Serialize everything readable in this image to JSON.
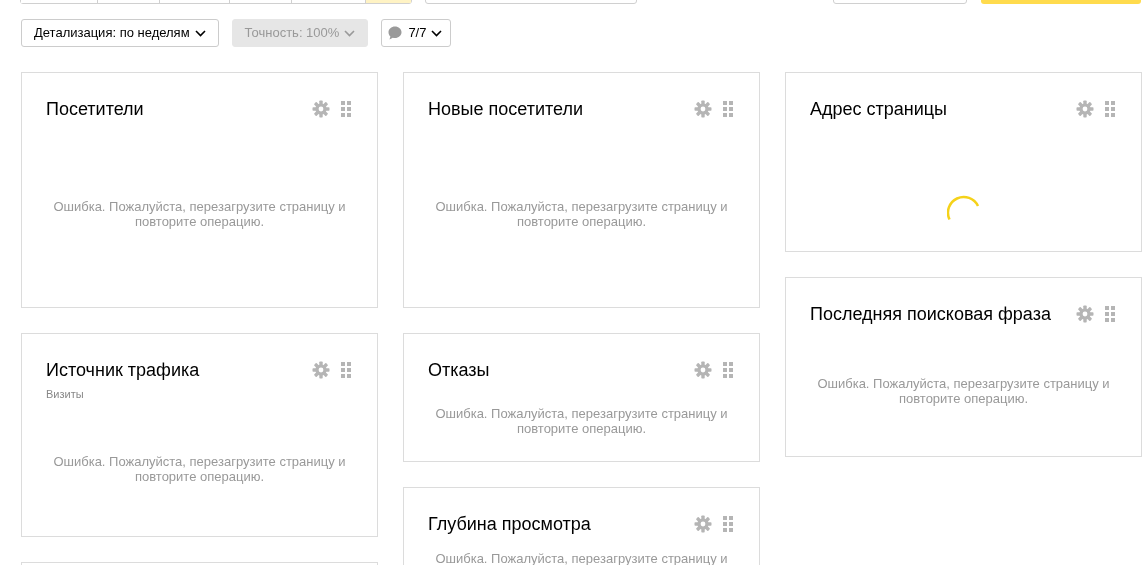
{
  "top_bar": {
    "segments": [
      {
        "selected": false
      },
      {
        "selected": false
      },
      {
        "selected": false
      },
      {
        "selected": false
      },
      {
        "selected": false
      },
      {
        "selected": true
      }
    ]
  },
  "filters": [
    {
      "kind": "dropdown",
      "label": "Детализация: по неделям",
      "disabled": false
    },
    {
      "kind": "dropdown",
      "label": "Точность: 100%",
      "disabled": true
    },
    {
      "kind": "comment",
      "label": "7/7",
      "disabled": false
    }
  ],
  "columns": [
    {
      "widgets": [
        {
          "kind": "error",
          "title": "Посетители",
          "message": "Ошибка. Пожалуйста, перезагрузите страницу и повторите операцию."
        },
        {
          "kind": "error",
          "title": "Источник трафика",
          "subtitle": "Визиты",
          "message": "Ошибка. Пожалуйста, перезагрузите страницу и повторите операцию."
        },
        {
          "kind": "cut"
        }
      ]
    },
    {
      "widgets": [
        {
          "kind": "error",
          "title": "Новые посетители",
          "message": "Ошибка. Пожалуйста, перезагрузите страницу и повторите операцию."
        },
        {
          "kind": "error",
          "title": "Отказы",
          "message": "Ошибка. Пожалуйста, перезагрузите страницу и повторите операцию."
        },
        {
          "kind": "error",
          "title": "Глубина просмотра",
          "message": "Ошибка. Пожалуйста, перезагрузите страницу и"
        }
      ]
    },
    {
      "widgets": [
        {
          "kind": "loading",
          "title": "Адрес страницы"
        },
        {
          "kind": "error",
          "title": "Последняя поисковая фраза",
          "message": "Ошибка. Пожалуйста, перезагрузите страницу и повторите операцию."
        }
      ]
    }
  ]
}
